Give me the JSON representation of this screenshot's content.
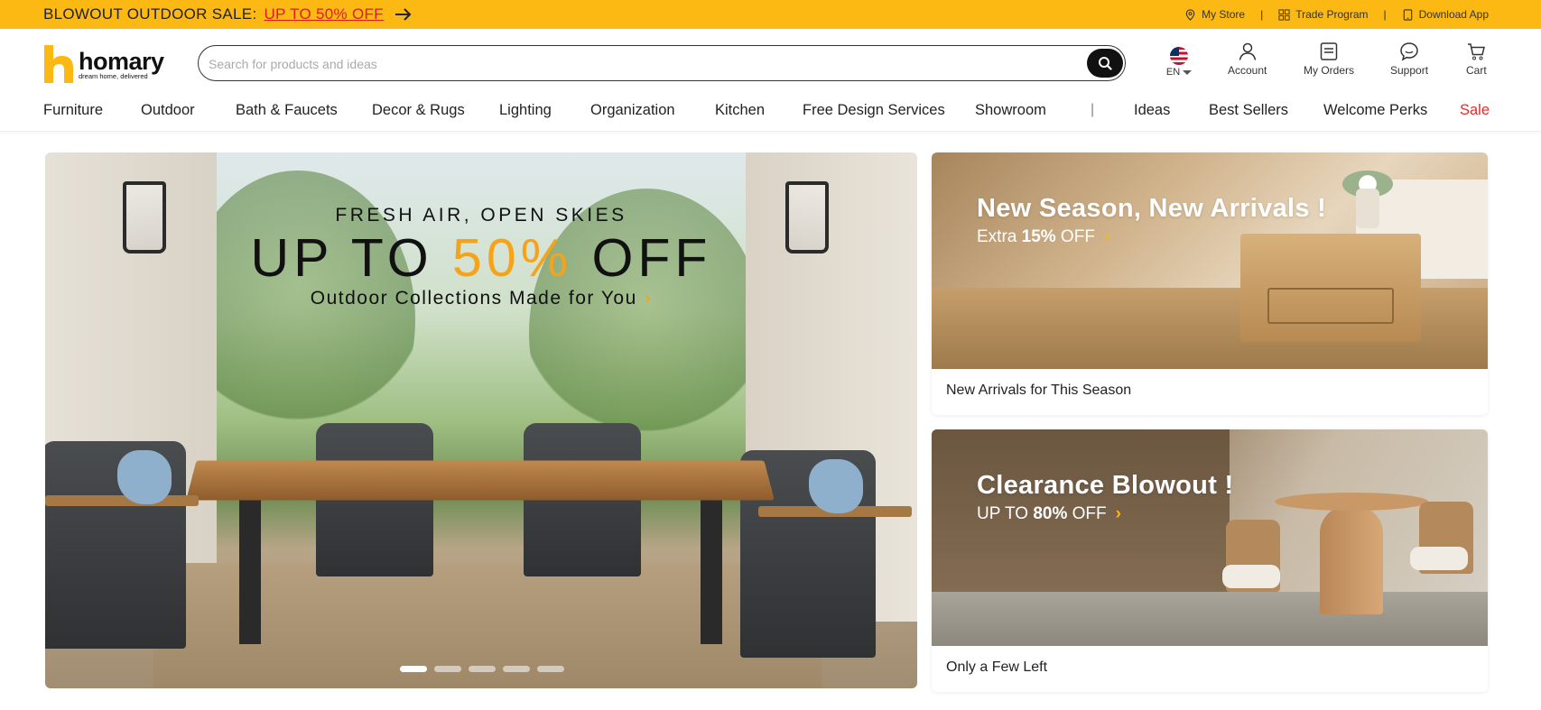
{
  "promo": {
    "lead": "BLOWOUT OUTDOOR SALE:",
    "highlight": "UP TO 50% OFF",
    "links": [
      {
        "label": "My Store",
        "icon": "location-pin-icon"
      },
      {
        "label": "Trade Program",
        "icon": "grid-icon"
      },
      {
        "label": "Download App",
        "icon": "phone-icon"
      }
    ]
  },
  "header": {
    "logo_word": "homary",
    "logo_tagline": "dream home, delivered",
    "search_placeholder": "Search for products and ideas",
    "language": "EN",
    "actions": [
      {
        "label": "Account",
        "icon": "user-icon"
      },
      {
        "label": "My Orders",
        "icon": "orders-icon"
      },
      {
        "label": "Support",
        "icon": "chat-icon"
      },
      {
        "label": "Cart",
        "icon": "cart-icon"
      }
    ]
  },
  "nav": {
    "items": [
      "Furniture",
      "Outdoor",
      "Bath & Faucets",
      "Decor & Rugs",
      "Lighting",
      "Organization",
      "Kitchen",
      "Free Design Services",
      "Showroom"
    ],
    "separator": "|",
    "secondary": [
      "Ideas",
      "Best Sellers",
      "Welcome Perks",
      "Sale"
    ]
  },
  "hero": {
    "kicker": "FRESH AIR, OPEN SKIES",
    "title_pre": "UP TO ",
    "title_accent": "50%",
    "title_post": " OFF",
    "subtitle": "Outdoor Collections Made for You",
    "chevron": "›",
    "slide_count": 5,
    "active_slide": 1
  },
  "cards": [
    {
      "title": "New Season, New Arrivals !",
      "sub_pre": "Extra ",
      "sub_bold": "15%",
      "sub_post": " OFF",
      "chevron": "›",
      "caption": "New Arrivals for This Season"
    },
    {
      "title": "Clearance Blowout !",
      "sub_pre": "UP TO ",
      "sub_bold": "80%",
      "sub_post": " OFF",
      "chevron": "›",
      "caption": "Only a Few Left"
    }
  ],
  "colors": {
    "promo_bg": "#fdb913",
    "accent_orange": "#f5a31a",
    "sale_red": "#e12a2a",
    "promo_link_red": "#e11b1b"
  }
}
